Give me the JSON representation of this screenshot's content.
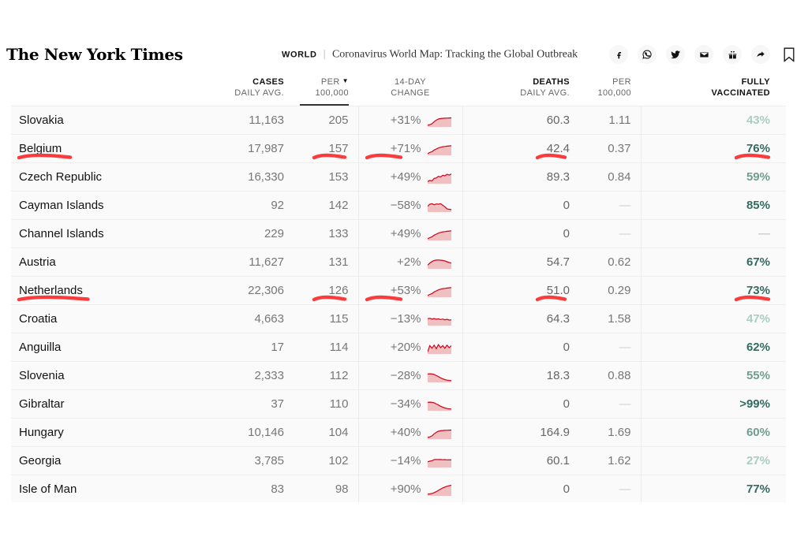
{
  "masthead": {
    "logo": "The New York Times",
    "kicker_section": "WORLD",
    "kicker_divider": "|",
    "kicker_title": "Coronavirus World Map: Tracking the Global Outbreak",
    "share_icons": [
      "facebook-icon",
      "whatsapp-icon",
      "twitter-icon",
      "email-icon",
      "gift-icon",
      "share-arrow-icon"
    ],
    "bookmark_icon": "bookmark-icon"
  },
  "table": {
    "columns": [
      {
        "key": "place",
        "line1": "",
        "line2": "",
        "bold_line": 0,
        "sorted": false
      },
      {
        "key": "cases",
        "line1": "CASES",
        "line2": "DAILY AVG.",
        "bold_line": 1,
        "sorted": false
      },
      {
        "key": "per",
        "line1": "PER",
        "line2": "100,000",
        "bold_line": 0,
        "sorted": true,
        "caret": "▼"
      },
      {
        "key": "change",
        "line1": "14-DAY",
        "line2": "CHANGE",
        "bold_line": 0,
        "sorted": false
      },
      {
        "key": "deaths",
        "line1": "DEATHS",
        "line2": "DAILY AVG.",
        "bold_line": 1,
        "sorted": false
      },
      {
        "key": "dper",
        "line1": "PER",
        "line2": "100,000",
        "bold_line": 0,
        "sorted": false
      },
      {
        "key": "vax",
        "line1": "FULLY",
        "line2": "VACCINATED",
        "bold_line": 2,
        "sorted": false
      }
    ],
    "rows": [
      {
        "place": "Slovakia",
        "cases": "11,163",
        "per": "205",
        "change": "+31%",
        "deaths": "60.3",
        "dper": "1.11",
        "vax": "43%",
        "vax_level": "light",
        "spark": "rising-flat"
      },
      {
        "place": "Belgium",
        "cases": "17,987",
        "per": "157",
        "change": "+71%",
        "deaths": "42.4",
        "dper": "0.37",
        "vax": "76%",
        "vax_level": "dark",
        "spark": "rising"
      },
      {
        "place": "Czech Republic",
        "cases": "16,330",
        "per": "153",
        "change": "+49%",
        "deaths": "89.3",
        "dper": "0.84",
        "vax": "59%",
        "vax_level": "mid",
        "spark": "rising-bumpy"
      },
      {
        "place": "Cayman Islands",
        "cases": "92",
        "per": "142",
        "change": "−58%",
        "deaths": "0",
        "dper": "—",
        "vax": "85%",
        "vax_level": "dark",
        "spark": "falling-bumpy"
      },
      {
        "place": "Channel Islands",
        "cases": "229",
        "per": "133",
        "change": "+49%",
        "deaths": "0",
        "dper": "—",
        "vax": "—",
        "vax_level": "dash",
        "spark": "rising"
      },
      {
        "place": "Austria",
        "cases": "11,627",
        "per": "131",
        "change": "+2%",
        "deaths": "54.7",
        "dper": "0.62",
        "vax": "67%",
        "vax_level": "dark",
        "spark": "hump"
      },
      {
        "place": "Netherlands",
        "cases": "22,306",
        "per": "126",
        "change": "+53%",
        "deaths": "51.0",
        "dper": "0.29",
        "vax": "73%",
        "vax_level": "dark",
        "spark": "rising"
      },
      {
        "place": "Croatia",
        "cases": "4,663",
        "per": "115",
        "change": "−13%",
        "deaths": "64.3",
        "dper": "1.58",
        "vax": "47%",
        "vax_level": "light",
        "spark": "flat-wavy"
      },
      {
        "place": "Anguilla",
        "cases": "17",
        "per": "114",
        "change": "+20%",
        "deaths": "0",
        "dper": "—",
        "vax": "62%",
        "vax_level": "dark",
        "spark": "spiky"
      },
      {
        "place": "Slovenia",
        "cases": "2,333",
        "per": "112",
        "change": "−28%",
        "deaths": "18.3",
        "dper": "0.88",
        "vax": "55%",
        "vax_level": "mid",
        "spark": "falling"
      },
      {
        "place": "Gibraltar",
        "cases": "37",
        "per": "110",
        "change": "−34%",
        "deaths": "0",
        "dper": "—",
        "vax": ">99%",
        "vax_level": "dark",
        "spark": "falling"
      },
      {
        "place": "Hungary",
        "cases": "10,146",
        "per": "104",
        "change": "+40%",
        "deaths": "164.9",
        "dper": "1.69",
        "vax": "60%",
        "vax_level": "mid",
        "spark": "rising-flat"
      },
      {
        "place": "Georgia",
        "cases": "3,785",
        "per": "102",
        "change": "−14%",
        "deaths": "60.1",
        "dper": "1.62",
        "vax": "27%",
        "vax_level": "light",
        "spark": "flat-step"
      },
      {
        "place": "Isle of Man",
        "cases": "83",
        "per": "98",
        "change": "+90%",
        "deaths": "0",
        "dper": "—",
        "vax": "77%",
        "vax_level": "dark",
        "spark": "rising-steep"
      }
    ],
    "annotated_rows": [
      "Belgium",
      "Netherlands"
    ],
    "annotated_columns": [
      "place",
      "per",
      "change",
      "deaths",
      "vax"
    ]
  },
  "colors": {
    "accent_red": "#fa3c3c",
    "spark_line": "#d0021b",
    "spark_fill": "#f0c0c0",
    "vax_dark": "#326b5f",
    "vax_mid": "#6f9e91",
    "vax_light": "#a9cdc2",
    "text_primary": "#121212",
    "text_muted": "#777777",
    "table_bg": "#fafafa"
  }
}
